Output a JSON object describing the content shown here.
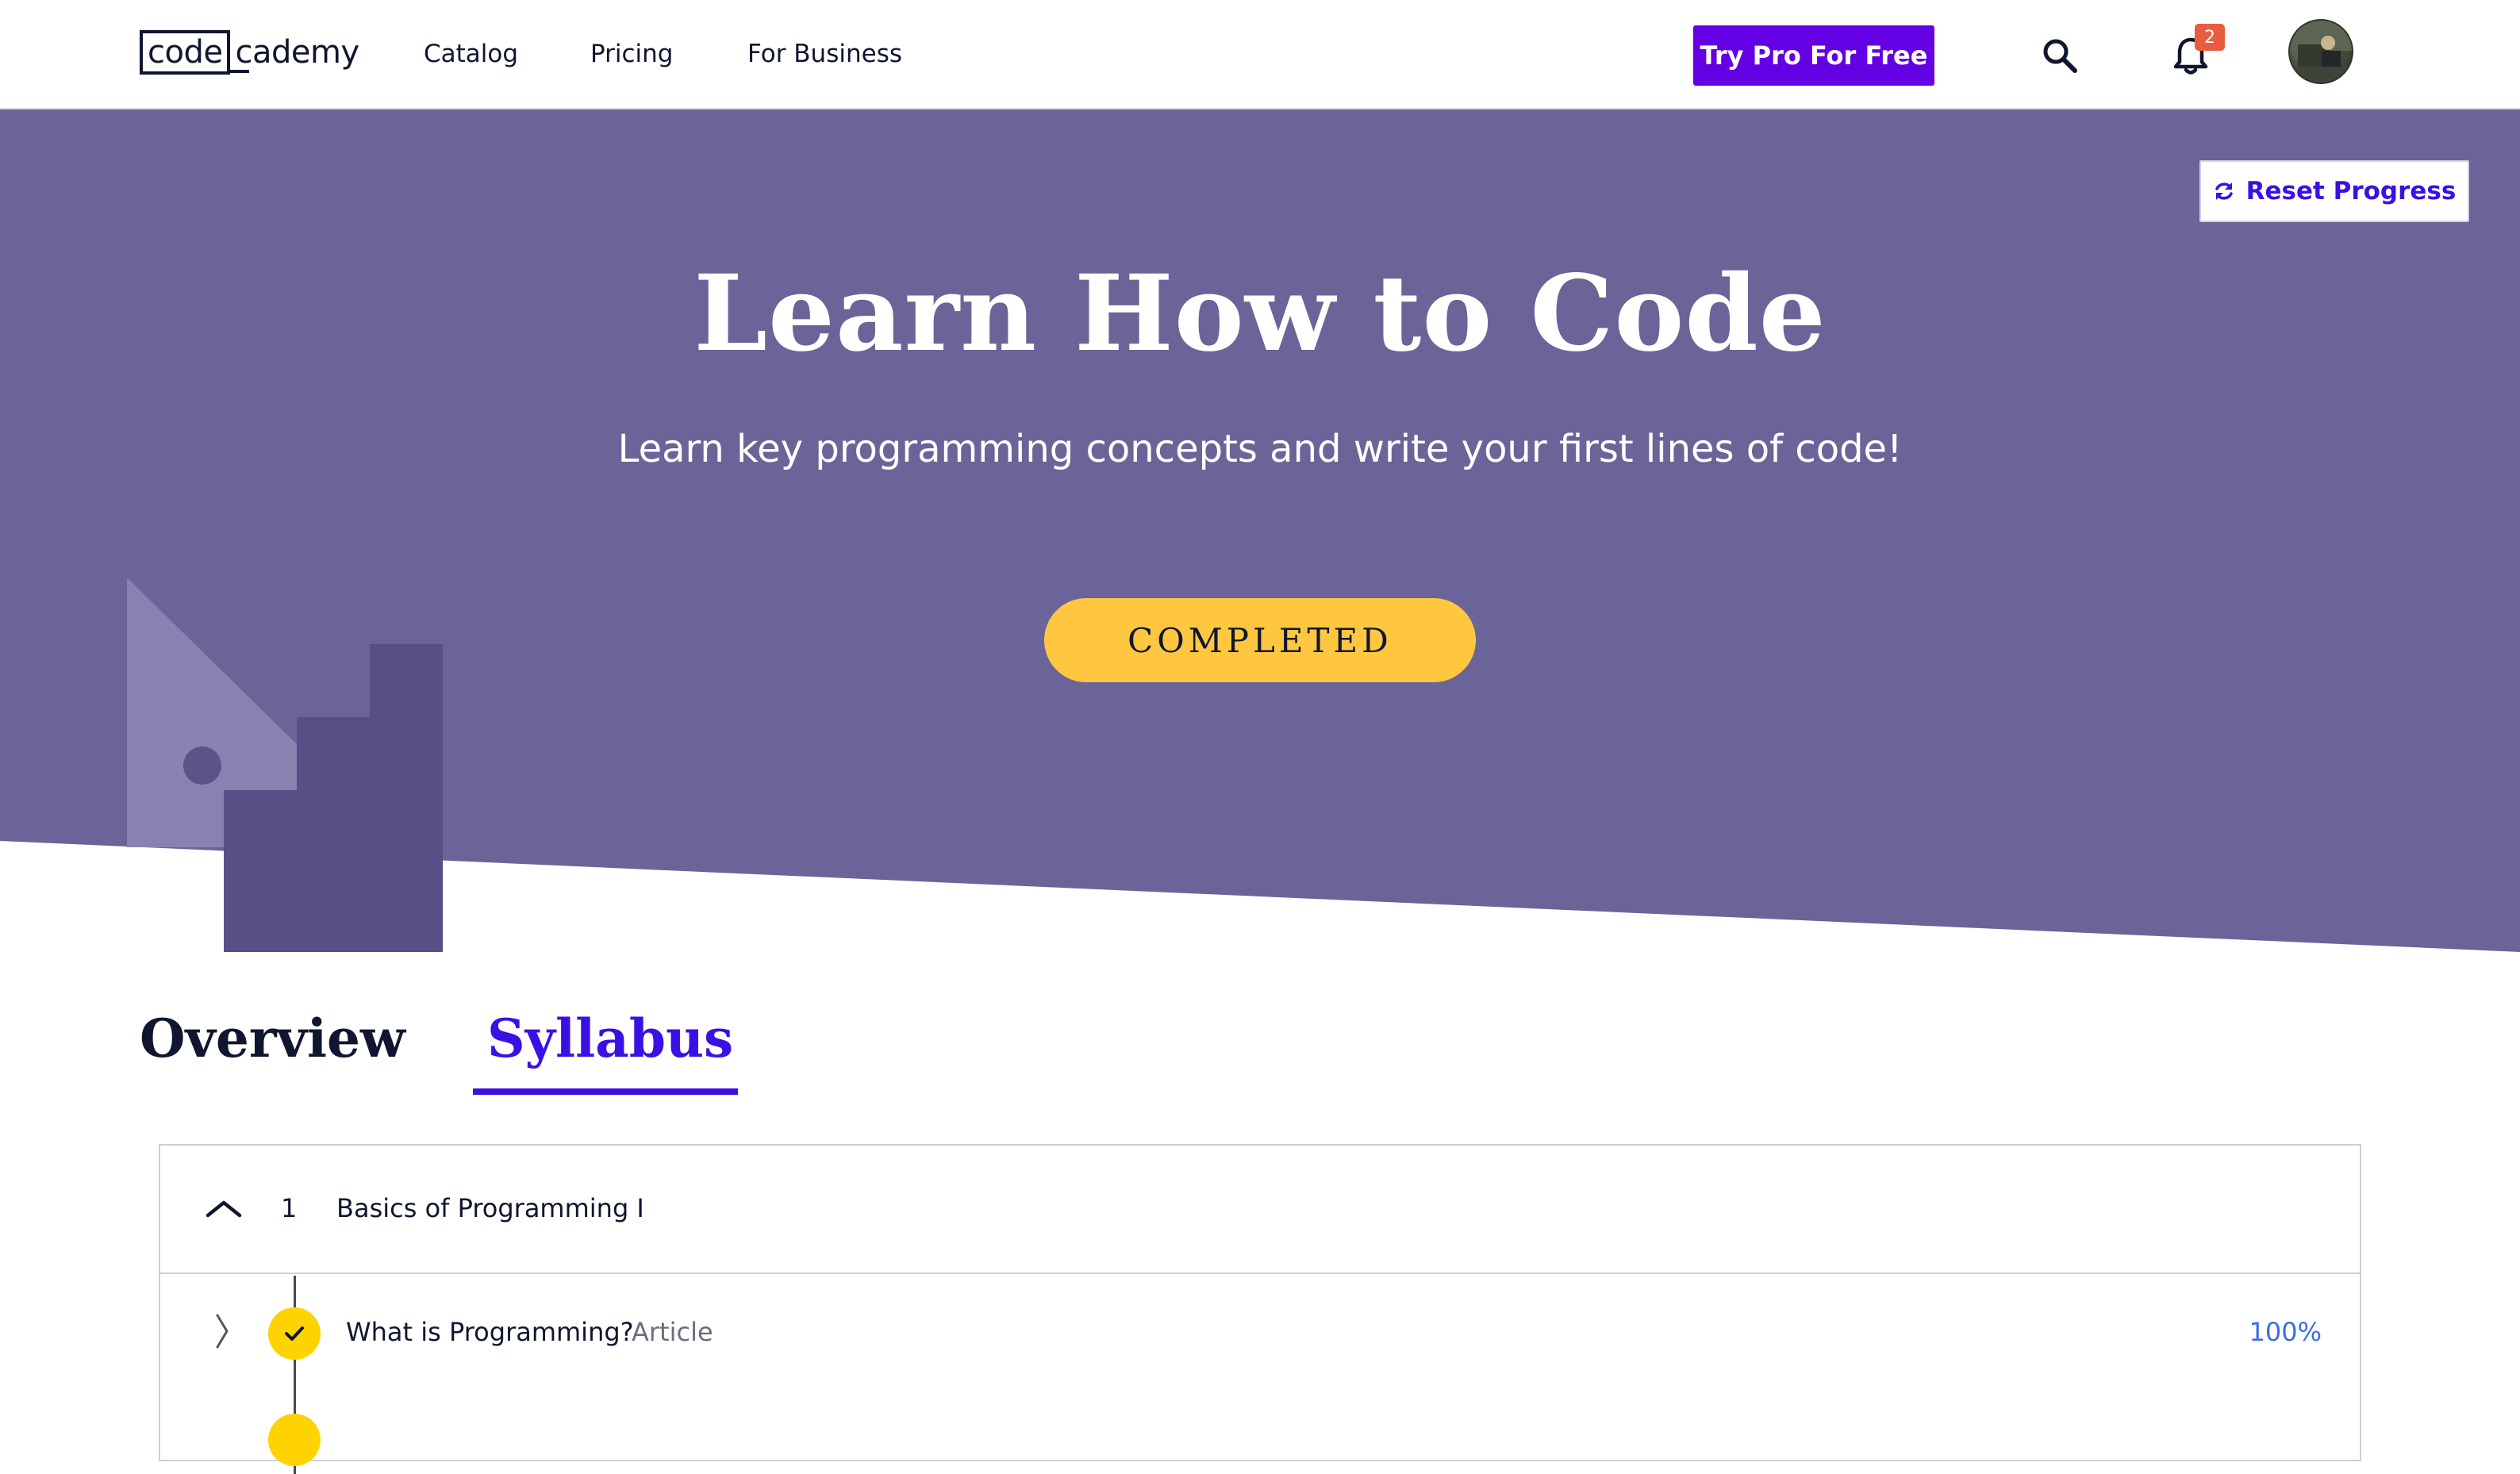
{
  "header": {
    "logo_code": "code",
    "logo_rest": "cademy",
    "nav": [
      "Catalog",
      "Pricing",
      "For Business"
    ],
    "cta_label": "Try Pro For Free",
    "notification_count": "2"
  },
  "hero": {
    "reset_label": "Reset Progress",
    "title": "Learn How to Code",
    "subtitle": "Learn key programming concepts and write your first lines of code!",
    "status_label": "COMPLETED"
  },
  "tabs": {
    "overview": "Overview",
    "syllabus": "Syllabus"
  },
  "syllabus": {
    "module": {
      "number": "1",
      "title": "Basics of Programming I"
    },
    "lessons": [
      {
        "title": "What is Programming?",
        "type": "Article",
        "progress": "100%"
      }
    ]
  },
  "colors": {
    "hero_bg": "#6b6498",
    "brand": "#3a10e5",
    "cta": "#6400e4",
    "badge": "#ffc740"
  }
}
